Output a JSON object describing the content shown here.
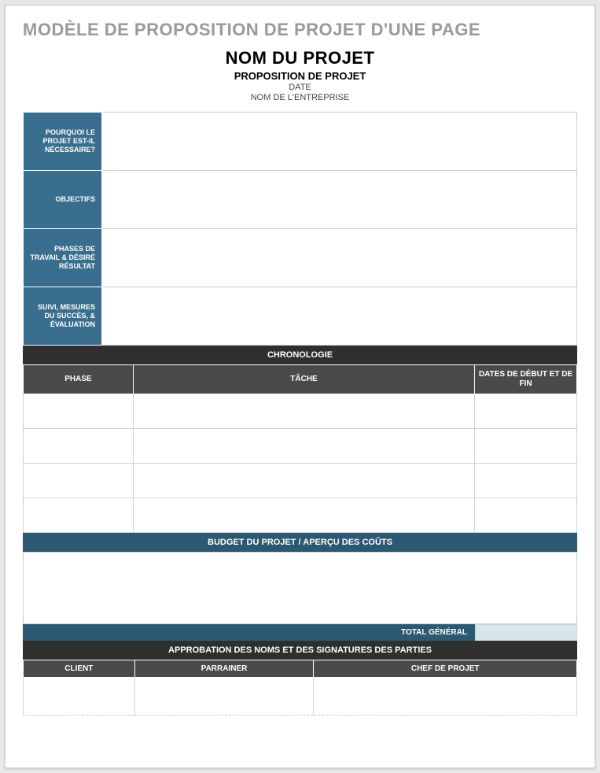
{
  "template_title": "MODÈLE DE PROPOSITION DE PROJET D'UNE PAGE",
  "header": {
    "project_name": "NOM DU PROJET",
    "subtitle": "PROPOSITION DE PROJET",
    "date": "DATE",
    "company": "NOM DE L'ENTREPRISE"
  },
  "info_rows": {
    "why": "POURQUOI LE PROJET EST-IL NÉCESSAIRE?",
    "objectives": "OBJECTIFS",
    "phases": "PHASES DE TRAVAIL & DÉSIRÉ RÉSULTAT",
    "monitoring": "SUIVI, MESURES DU SUCCÈS, & ÉVALUATION"
  },
  "timeline": {
    "title": "CHRONOLOGIE",
    "columns": {
      "phase": "PHASE",
      "task": "TÂCHE",
      "dates": "DATES DE DÉBUT ET DE FIN"
    },
    "rows": [
      {
        "phase": "",
        "task": "",
        "dates": ""
      },
      {
        "phase": "",
        "task": "",
        "dates": ""
      },
      {
        "phase": "",
        "task": "",
        "dates": ""
      },
      {
        "phase": "",
        "task": "",
        "dates": ""
      }
    ]
  },
  "budget": {
    "title": "BUDGET DU PROJET / APERÇU DES COÛTS",
    "total_label": "TOTAL GÉNÉRAL",
    "total_value": ""
  },
  "approval": {
    "title": "APPROBATION DES NOMS ET DES SIGNATURES DES PARTIES",
    "columns": {
      "client": "CLIENT",
      "sponsor": "PARRAINER",
      "manager": "CHEF DE PROJET"
    },
    "values": {
      "client": "",
      "sponsor": "",
      "manager": ""
    }
  }
}
